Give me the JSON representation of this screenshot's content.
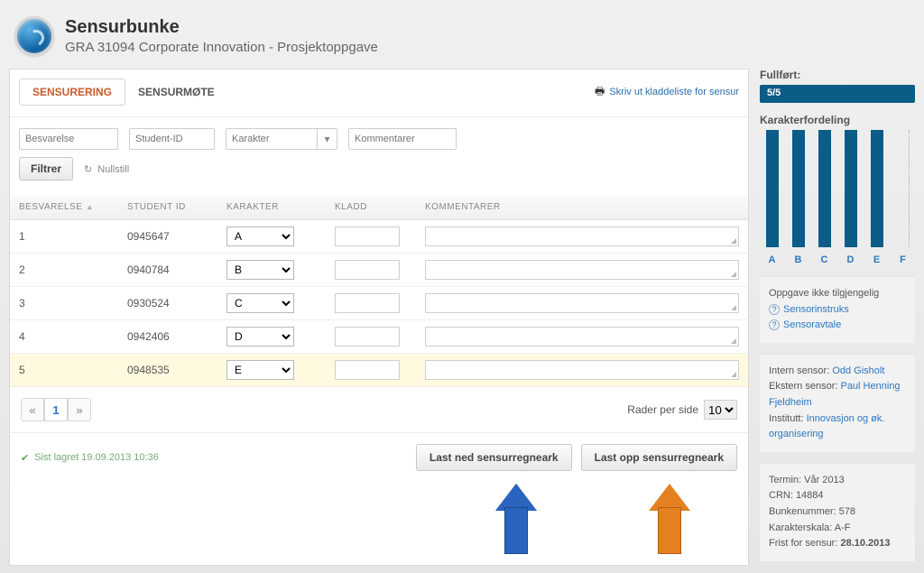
{
  "header": {
    "title": "Sensurbunke",
    "subtitle": "GRA 31094 Corporate Innovation - Prosjektoppgave"
  },
  "tabs": {
    "sensurering": "SENSURERING",
    "sensurmote": "SENSURMØTE"
  },
  "print_link": "Skriv ut kladdeliste for sensur",
  "filters": {
    "besvarelse": "Besvarelse",
    "student_id": "Student-ID",
    "karakter": "Karakter",
    "kommentarer": "Kommentarer",
    "filtrer": "Filtrer",
    "nullstill": "Nullstill"
  },
  "columns": {
    "besvarelse": "BESVARELSE",
    "student_id": "STUDENT ID",
    "karakter": "KARAKTER",
    "kladd": "KLADD",
    "kommentarer": "KOMMENTARER"
  },
  "rows": [
    {
      "n": "1",
      "student": "0945647",
      "grade": "A"
    },
    {
      "n": "2",
      "student": "0940784",
      "grade": "B"
    },
    {
      "n": "3",
      "student": "0930524",
      "grade": "C"
    },
    {
      "n": "4",
      "student": "0942406",
      "grade": "D"
    },
    {
      "n": "5",
      "student": "0948535",
      "grade": "E"
    }
  ],
  "pager": {
    "prev": "«",
    "page": "1",
    "next": "»",
    "rows_per_side": "Rader per side",
    "rows_value": "10"
  },
  "saved": "Sist lagret 19.09.2013 10:36",
  "actions": {
    "download": "Last ned sensurregneark",
    "upload": "Last opp sensurregneark"
  },
  "side": {
    "fullfort": "Fullført:",
    "progress": "5/5",
    "karakterfordeling": "Karakterfordeling",
    "dist_labels": [
      "A",
      "B",
      "C",
      "D",
      "E",
      "F"
    ],
    "oppgave": "Oppgave ikke tilgjengelig",
    "sensorinstruks": "Sensorinstruks",
    "sensoravtale": "Sensoravtale",
    "intern_sensor_lbl": "Intern sensor:",
    "intern_sensor": "Odd Gisholt",
    "ekstern_sensor_lbl": "Ekstern sensor:",
    "ekstern_sensor": "Paul Henning Fjeldheim",
    "institutt_lbl": "Institutt:",
    "institutt": "Innovasjon og øk. organisering",
    "termin": "Termin: Vår 2013",
    "crn": "CRN: 14884",
    "bunkenummer": "Bunkenummer: 578",
    "karakterskala": "Karakterskala: A-F",
    "frist_lbl": "Frist for sensur:",
    "frist": "28.10.2013"
  },
  "chart_data": {
    "type": "bar",
    "categories": [
      "A",
      "B",
      "C",
      "D",
      "E",
      "F"
    ],
    "values": [
      1,
      1,
      1,
      1,
      1,
      0
    ],
    "title": "Karakterfordeling",
    "xlabel": "",
    "ylabel": "",
    "ylim": [
      0,
      1
    ]
  }
}
